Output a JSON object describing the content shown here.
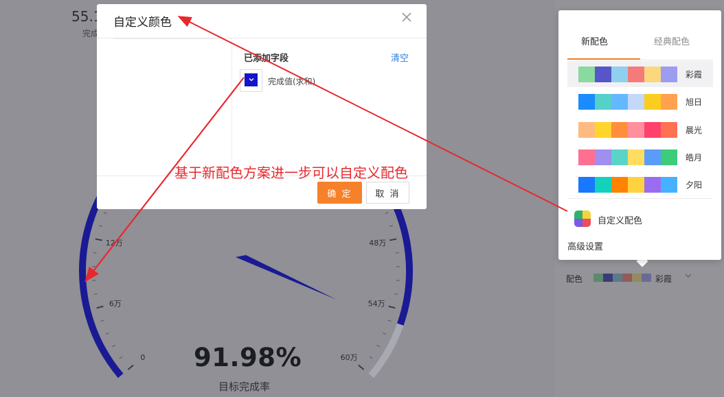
{
  "dashboard": {
    "top_value": "55.1",
    "top_sub": "完成",
    "gauge_value": "91.98%",
    "gauge_label": "目标完成率",
    "gauge_percent": 0.9198,
    "ticks": [
      "0",
      "6万",
      "12万",
      "48万",
      "54万",
      "60万"
    ],
    "gauge_color": "#1a1a94",
    "gauge_track_color": "#a9a9b3"
  },
  "modal": {
    "title": "自定义颜色",
    "added_label": "已添加字段",
    "clear_label": "清空",
    "field_name": "完成值(求和)",
    "field_color": "#1414c8",
    "field_icon": "chevron-down-icon",
    "ok_label": "确 定",
    "cancel_label": "取 消",
    "close_icon": "close-icon"
  },
  "popover": {
    "tabs": [
      {
        "label": "新配色",
        "active": true
      },
      {
        "label": "经典配色",
        "active": false
      }
    ],
    "palettes": [
      {
        "name": "彩霞",
        "selected": true,
        "colors": [
          "#8ad9a0",
          "#5656c8",
          "#8fd0ef",
          "#f57b7b",
          "#fbd77e",
          "#9c9cf0"
        ]
      },
      {
        "name": "旭日",
        "selected": false,
        "colors": [
          "#1a8cff",
          "#54d1c8",
          "#63b8ff",
          "#c4d8f7",
          "#fccd20",
          "#ffa250"
        ]
      },
      {
        "name": "晨光",
        "selected": false,
        "colors": [
          "#ffba80",
          "#ffd52c",
          "#ff8f3b",
          "#ff8f9f",
          "#ff4269",
          "#ff7152"
        ]
      },
      {
        "name": "皓月",
        "selected": false,
        "colors": [
          "#ff7090",
          "#9f8ff0",
          "#5ad4c8",
          "#ffdd60",
          "#5b9cf8",
          "#3ccc7a"
        ]
      },
      {
        "name": "夕阳",
        "selected": false,
        "colors": [
          "#1978ff",
          "#12d1bd",
          "#ff8300",
          "#ffd33f",
          "#9a6df0",
          "#46b2ff"
        ]
      }
    ],
    "custom_label": "自定义配色",
    "advanced_label": "高级设置"
  },
  "color_setting": {
    "label": "配色",
    "current": "彩霞",
    "swatches": [
      "#5d8a6e",
      "#3a3a7a",
      "#5a7a8a",
      "#945a5a",
      "#958a60",
      "#6a6a9a"
    ]
  },
  "annotation": {
    "text": "基于新配色方案进一步可以自定义配色",
    "color": "#e8282d"
  }
}
